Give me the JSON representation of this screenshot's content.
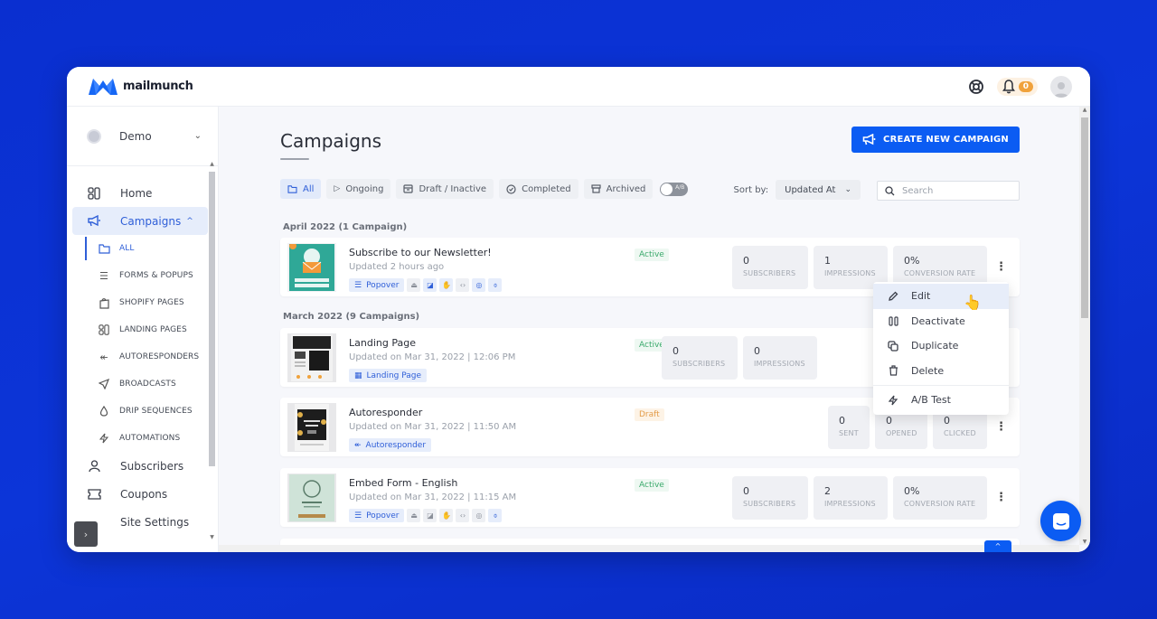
{
  "brand": {
    "name": "mailmunch",
    "color": "#0b5cf3"
  },
  "topbar": {
    "help_icon": "lifebuoy-icon",
    "notifications_count": "0",
    "avatar_icon": "user-avatar-icon"
  },
  "sidebar": {
    "workspace": "Demo",
    "nav": [
      {
        "label": "Home",
        "icon": "home-grid-icon"
      },
      {
        "label": "Campaigns",
        "icon": "megaphone-icon",
        "active": true
      }
    ],
    "sub": [
      {
        "label": "ALL",
        "icon": "folder-icon",
        "active": true
      },
      {
        "label": "FORMS & POPUPS",
        "icon": "list-icon"
      },
      {
        "label": "SHOPIFY PAGES",
        "icon": "shopify-bag-icon"
      },
      {
        "label": "LANDING PAGES",
        "icon": "grid-icon"
      },
      {
        "label": "AUTORESPONDERS",
        "icon": "reply-all-icon"
      },
      {
        "label": "BROADCASTS",
        "icon": "send-icon"
      },
      {
        "label": "DRIP SEQUENCES",
        "icon": "drop-icon"
      },
      {
        "label": "AUTOMATIONS",
        "icon": "bolt-icon"
      }
    ],
    "bottom": [
      {
        "label": "Subscribers",
        "icon": "user-icon"
      },
      {
        "label": "Coupons",
        "icon": "ticket-icon"
      },
      {
        "label": "Site Settings",
        "icon": "settings-icon"
      }
    ]
  },
  "main": {
    "title": "Campaigns",
    "create_button": "CREATE NEW CAMPAIGN",
    "filters": [
      {
        "label": "All",
        "active": true
      },
      {
        "label": "Ongoing"
      },
      {
        "label": "Draft / Inactive"
      },
      {
        "label": "Completed"
      },
      {
        "label": "Archived"
      }
    ],
    "toggle_label": "A/B",
    "sort_label": "Sort by:",
    "sort_value": "Updated At",
    "search_placeholder": "Search",
    "groups": [
      {
        "label": "April 2022 (1 Campaign)"
      },
      {
        "label": "March 2022 (9 Campaigns)"
      }
    ],
    "campaigns": [
      {
        "title": "Subscribe to our Newsletter!",
        "updated": "Updated 2 hours ago",
        "type": "Popover",
        "status": "Active",
        "stats": [
          {
            "value": "0",
            "label": "SUBSCRIBERS"
          },
          {
            "value": "1",
            "label": "IMPRESSIONS"
          },
          {
            "value": "0%",
            "label": "CONVERSION RATE"
          }
        ]
      },
      {
        "title": "Landing Page",
        "updated": "Updated on Mar 31, 2022 | 12:06 PM",
        "type": "Landing Page",
        "status": "Active",
        "stats": [
          {
            "value": "0",
            "label": "SUBSCRIBERS"
          },
          {
            "value": "0",
            "label": "IMPRESSIONS"
          }
        ]
      },
      {
        "title": "Autoresponder",
        "updated": "Updated on Mar 31, 2022 | 11:50 AM",
        "type": "Autoresponder",
        "status": "Draft",
        "stats": [
          {
            "value": "0",
            "label": "SENT"
          },
          {
            "value": "0",
            "label": "OPENED"
          },
          {
            "value": "0",
            "label": "CLICKED"
          }
        ]
      },
      {
        "title": "Embed Form - English",
        "updated": "Updated on Mar 31, 2022 | 11:15 AM",
        "type": "Popover",
        "status": "Active",
        "stats": [
          {
            "value": "0",
            "label": "SUBSCRIBERS"
          },
          {
            "value": "2",
            "label": "IMPRESSIONS"
          },
          {
            "value": "0%",
            "label": "CONVERSION RATE"
          }
        ]
      }
    ],
    "context_menu": [
      {
        "label": "Edit",
        "icon": "pencil-icon"
      },
      {
        "label": "Deactivate",
        "icon": "pause-icon"
      },
      {
        "label": "Duplicate",
        "icon": "copy-icon"
      },
      {
        "label": "Delete",
        "icon": "trash-icon"
      },
      {
        "label": "A/B Test",
        "icon": "bolt-icon"
      }
    ]
  }
}
